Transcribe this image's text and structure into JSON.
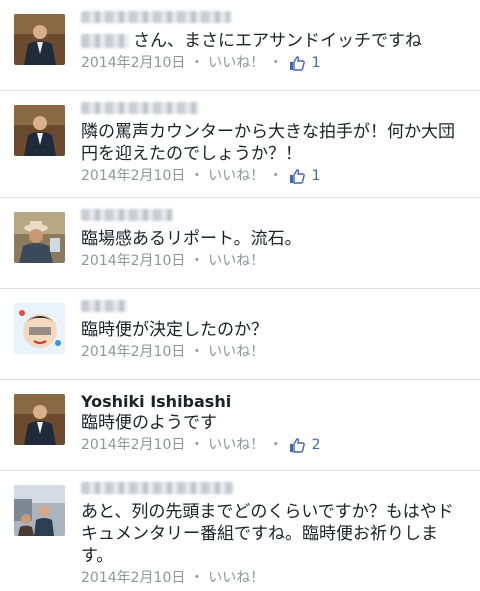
{
  "comments": [
    {
      "avatar": "avatar-man-suit",
      "name_blurred": true,
      "text_prefix_blurred": true,
      "text": "さん、まさにエアサンドイッチですね",
      "date": "2014年2月10日",
      "separator": "・",
      "like_label": "いいね！",
      "like_count": "1"
    },
    {
      "avatar": "avatar-man-suit",
      "name_blurred": true,
      "text": "隣の罵声カウンターから大きな拍手が！何か大団円を迎えたのでしょうか？！",
      "date": "2014年2月10日",
      "separator": "・",
      "like_label": "いいね！",
      "like_count": "1"
    },
    {
      "avatar": "avatar-man-hat",
      "name_blurred": true,
      "text": "臨場感あるリポート。流石。",
      "date": "2014年2月10日",
      "separator": "・",
      "like_label": "いいね！"
    },
    {
      "avatar": "avatar-cartoon",
      "name_blurred": true,
      "text": "臨時便が決定したのか？",
      "date": "2014年2月10日",
      "separator": "・",
      "like_label": "いいね！"
    },
    {
      "avatar": "avatar-man-suit",
      "name": "Yoshiki Ishibashi",
      "text": "臨時便のようです",
      "date": "2014年2月10日",
      "separator": "・",
      "like_label": "いいね！",
      "like_count": "2"
    },
    {
      "avatar": "avatar-street",
      "name_blurred": true,
      "text": "あと、列の先頭までどのくらいですか？もはやドキュメンタリー番組ですね。臨時便お祈りします。",
      "date": "2014年2月10日",
      "separator": "・",
      "like_label": "いいね！"
    }
  ],
  "colors": {
    "text": "#1d2129",
    "meta": "#90949c",
    "like_blue": "#4267b2",
    "divider": "#dcdee3"
  }
}
